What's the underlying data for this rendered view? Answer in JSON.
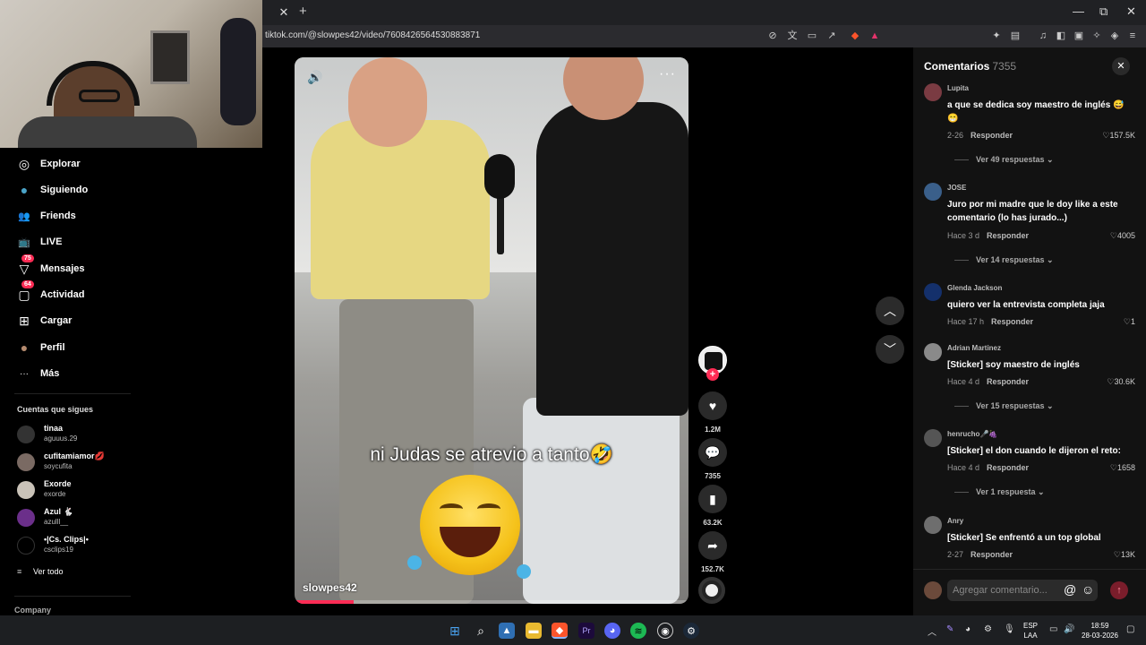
{
  "browser": {
    "url": "tiktok.com/@slowpes42/video/7608426564530883871",
    "new_tab": "+",
    "tab_close": "✕",
    "window_controls": [
      "—",
      "⧉",
      "✕"
    ]
  },
  "sidebar": {
    "items": [
      {
        "label": "Explorar",
        "icon": "compass-icon",
        "glyph": "◎"
      },
      {
        "label": "Siguiendo",
        "icon": "following-avatar-icon",
        "glyph": "●"
      },
      {
        "label": "Friends",
        "icon": "friends-icon",
        "glyph": "👥"
      },
      {
        "label": "LIVE",
        "icon": "live-tv-icon",
        "glyph": "📺"
      },
      {
        "label": "Mensajes",
        "icon": "paper-plane-icon",
        "glyph": "▽",
        "badge": "75"
      },
      {
        "label": "Actividad",
        "icon": "activity-icon",
        "glyph": "▢",
        "badge": "64"
      },
      {
        "label": "Cargar",
        "icon": "upload-plus-icon",
        "glyph": "⊞"
      },
      {
        "label": "Perfil",
        "icon": "profile-avatar-icon",
        "glyph": "●"
      },
      {
        "label": "Más",
        "icon": "more-dots-icon",
        "glyph": "···"
      }
    ],
    "following_title": "Cuentas que sigues",
    "accounts": [
      {
        "name": "tinaa",
        "handle": "aguuus.29",
        "color": "#333333"
      },
      {
        "name": "cufitamiamor💋",
        "handle": "soycufita",
        "color": "#7a6a63"
      },
      {
        "name": "Exorde",
        "handle": "exorde",
        "color": "#c9c2b8"
      },
      {
        "name": "Azul 🐇",
        "handle": "azulll__",
        "color": "#6b2f8a"
      },
      {
        "name": "•|Cs. Clips|•",
        "handle": "csclips19",
        "color": "#000000"
      }
    ],
    "see_all": "Ver todo",
    "company": "Company"
  },
  "video": {
    "caption": "ni Judas se atrevio a tanto🤣",
    "author": "slowpes42",
    "progress": 0.15,
    "volume_icon": "🔊",
    "more_icon": "···"
  },
  "actions": {
    "likes": "1.2M",
    "comments": "7355",
    "saves": "63.2K",
    "shares": "152.7K"
  },
  "comments_panel": {
    "title": "Comentarios",
    "count": "7355",
    "input_placeholder": "Agregar comentario...",
    "comments": [
      {
        "user": "Lupita",
        "text": "a que se dedica soy maestro de inglés 😅 😁",
        "time": "2-26",
        "reply": "Responder",
        "likes": "♡157.5K",
        "more": "Ver 49 respuestas ⌄",
        "avatar": "#7a3b42"
      },
      {
        "user": "JOSE",
        "text": "Juro por mi madre que le doy like a este comentario (lo has jurado...)",
        "time": "Hace 3 d",
        "reply": "Responder",
        "likes": "♡4005",
        "more": "Ver 14 respuestas ⌄",
        "avatar": "#3a5f8a"
      },
      {
        "user": "Glenda Jackson",
        "text": "quiero ver la entrevista completa jaja",
        "time": "Hace 17 h",
        "reply": "Responder",
        "likes": "♡1",
        "more": "",
        "avatar": "#14306b"
      },
      {
        "user": "Adrian Martinez",
        "text": "[Sticker] soy maestro de inglés",
        "time": "Hace 4 d",
        "reply": "Responder",
        "likes": "♡30.6K",
        "more": "Ver 15 respuestas ⌄",
        "avatar": "#8a8a8a"
      },
      {
        "user": "henrucho🎤🍇",
        "text": "[Sticker] el don cuando le dijeron el reto:",
        "time": "Hace 4 d",
        "reply": "Responder",
        "likes": "♡1658",
        "more": "Ver 1 respuesta ⌄",
        "avatar": "#555555"
      },
      {
        "user": "Anry",
        "text": "[Sticker] Se enfrentó a un top global",
        "time": "2-27",
        "reply": "Responder",
        "likes": "♡13K",
        "more": "",
        "avatar": "#6e6e6e"
      }
    ]
  },
  "taskbar": {
    "lang_top": "ESP",
    "lang_bottom": "LAA",
    "time": "18:59",
    "date": "28-03-2026"
  },
  "colors": {
    "accent": "#fe2c55",
    "panel": "#121212"
  }
}
